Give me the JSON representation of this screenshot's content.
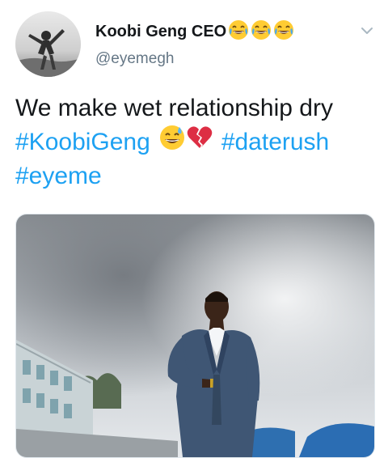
{
  "author": {
    "display_name": "Koobi Geng CEO",
    "name_emojis": [
      "face-with-tears-of-joy",
      "face-with-tears-of-joy",
      "face-with-tears-of-joy"
    ],
    "handle": "@eyemegh"
  },
  "tweet": {
    "line1": "We make wet relationship dry",
    "hashtag_1": "#KoobiGeng",
    "inline_emojis": [
      "grinning-face-with-sweat",
      "broken-heart"
    ],
    "hashtag_2": "#daterush",
    "hashtag_3": "#eyeme"
  },
  "media": {
    "alt_subject": "photo of a man in a blue suit posing outdoors"
  },
  "colors": {
    "link": "#1da1f2",
    "text": "#14171a",
    "secondary": "#657786",
    "border": "#e1e8ed"
  },
  "icons": {
    "more": "chevron-down-icon"
  }
}
